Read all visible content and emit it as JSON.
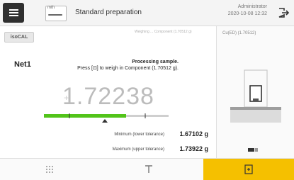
{
  "header": {
    "method_tag": "mth",
    "title": "Standard preparation",
    "user": "Administrator",
    "datetime": "2020-10-08   12:32"
  },
  "left": {
    "isocal_label": "isoCAL",
    "breadcrumb": "Weighing ... Component (1.70512 g)",
    "net_label": "Net1",
    "message_line1": "Processing sample.",
    "message_line2": "Press [⊡] to weigh in Component (1.70512 g).",
    "weight_sign": "+",
    "weight_value": "1.72238",
    "tolerance": {
      "min_label": "Minimum (lower tolerance)",
      "min_value": "1.67102 g",
      "max_label": "Maximum (upper tolerance)",
      "max_value": "1.73922 g"
    }
  },
  "right": {
    "title": "Cu(ED) (1.70512)"
  },
  "gauge": {
    "fill_fraction": 0.66,
    "colors": {
      "fill": "#52c41a",
      "track": "#cfcfcf"
    }
  },
  "bottom": {
    "tare_icon": "tare-icon",
    "zero_icon": "zero-icon",
    "ok_icon": "confirm-weigh-icon"
  },
  "colors": {
    "accent": "#f5c000",
    "header_bg": "#f4f4f4",
    "menu_bg": "#2f2f2f"
  }
}
